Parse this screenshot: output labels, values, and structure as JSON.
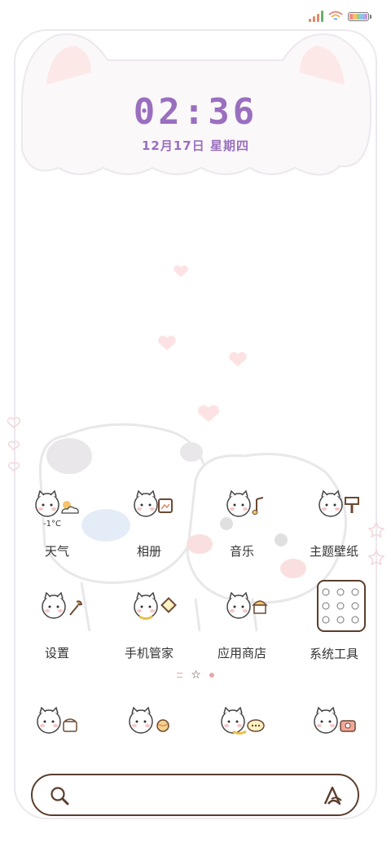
{
  "status_bar": {
    "signal_icon": "signal-icon",
    "wifi_icon": "wifi-icon",
    "battery_icon": "battery-icon"
  },
  "clock": {
    "time": "02:36",
    "date": "12月17日 星期四"
  },
  "apps": [
    {
      "label": "天气",
      "badge": "-1°C",
      "icon": "weather-icon"
    },
    {
      "label": "相册",
      "icon": "gallery-icon"
    },
    {
      "label": "音乐",
      "icon": "music-icon"
    },
    {
      "label": "主题壁纸",
      "icon": "theme-icon"
    },
    {
      "label": "设置",
      "icon": "settings-icon"
    },
    {
      "label": "手机管家",
      "icon": "phone-manager-icon"
    },
    {
      "label": "应用商店",
      "icon": "app-store-icon"
    },
    {
      "label": "系统工具",
      "icon": "system-tools-icon"
    }
  ],
  "dock": [
    {
      "icon": "phone-icon"
    },
    {
      "icon": "browser-icon"
    },
    {
      "icon": "messages-icon"
    },
    {
      "icon": "camera-icon"
    }
  ],
  "colors": {
    "accent": "#9a6fbf",
    "frame": "#ece8ee",
    "search_border": "#5a3e2e",
    "cat_pink": "#f7c6c6"
  }
}
